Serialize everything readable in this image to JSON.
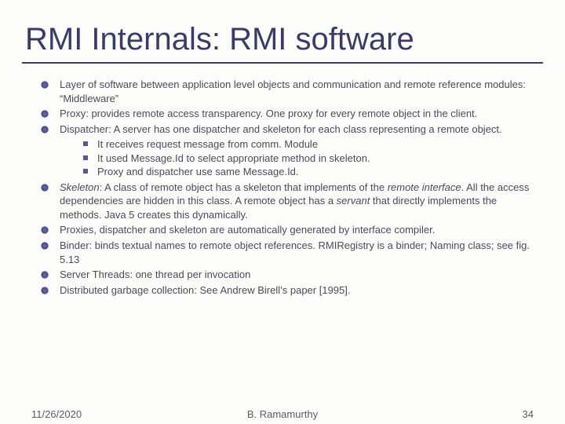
{
  "title": "RMI Internals: RMI software",
  "bullets": {
    "b1": "Layer of software between application level objects and communication and remote reference modules: “Middleware”",
    "b2": "Proxy: provides remote access transparency. One proxy for every remote object in the client.",
    "b3": "Dispatcher: A server has one dispatcher and skeleton for each class representing a remote object.",
    "b3s1": "It receives request message from comm. Module",
    "b3s2": "It used Message.Id to select appropriate method in skeleton.",
    "b3s3": "Proxy and dispatcher use same Message.Id.",
    "b4_i1": "Skeleton",
    "b4_t1": ": A class of remote object has a skeleton that implements of the ",
    "b4_i2": "remote interface",
    "b4_t2": ". All the access dependencies are hidden in this class. A remote object has a ",
    "b4_i3": "servant",
    "b4_t3": " that directly implements the methods. Java 5 creates this dynamically.",
    "b5": "Proxies, dispatcher and skeleton are automatically generated by interface compiler.",
    "b6": "Binder: binds textual names to remote object references. RMIRegistry is a binder; Naming class; see fig. 5.13",
    "b7": "Server Threads: one thread per invocation",
    "b8": "Distributed garbage collection: See Andrew Birell’s paper [1995]."
  },
  "footer": {
    "date": "11/26/2020",
    "author": "B. Ramamurthy",
    "page": "34"
  }
}
